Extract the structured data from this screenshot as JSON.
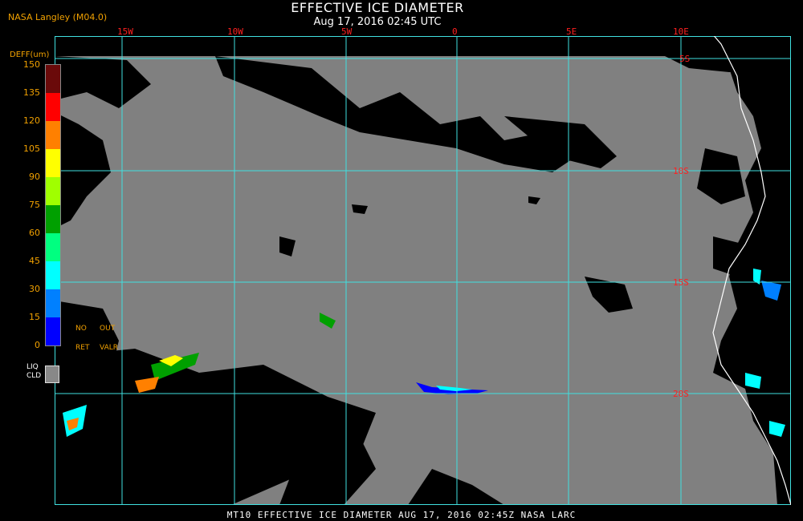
{
  "header": {
    "title": "EFFECTIVE ICE DIAMETER",
    "subtitle": "Aug 17, 2016 02:45 UTC",
    "producer": "NASA Langley (M04.0)"
  },
  "map": {
    "lon_labels": [
      "15W",
      "10W",
      "5W",
      "0",
      "5E",
      "10E"
    ],
    "lat_labels": [
      "5S",
      "10S",
      "15S",
      "20S"
    ],
    "colors": {
      "background": "#000000",
      "clear_ocean": "#808080",
      "grid": "#40e0e0",
      "coast": "#ffffff",
      "label": "#ff2020"
    }
  },
  "colorbar": {
    "label": "DEFF(um)",
    "ticks": [
      "150",
      "135",
      "120",
      "105",
      "90",
      "75",
      "60",
      "45",
      "30",
      "15",
      "0"
    ],
    "colors": [
      "#6a0a0a",
      "#ff0000",
      "#ff8000",
      "#ffff00",
      "#a0ff00",
      "#00a000",
      "#00ff80",
      "#00ffff",
      "#0080ff",
      "#0000ff",
      "#8040ff"
    ],
    "no_ret_top": "NO",
    "no_ret_bottom": "RET",
    "out_valr_top": "OUT",
    "out_valr_bottom": "VALR",
    "liq_top": "LIQ",
    "liq_bottom": "CLD"
  },
  "footer": {
    "text": "MT10  EFFECTIVE ICE DIAMETER   AUG 17, 2016 02:45Z   NASA LARC"
  }
}
